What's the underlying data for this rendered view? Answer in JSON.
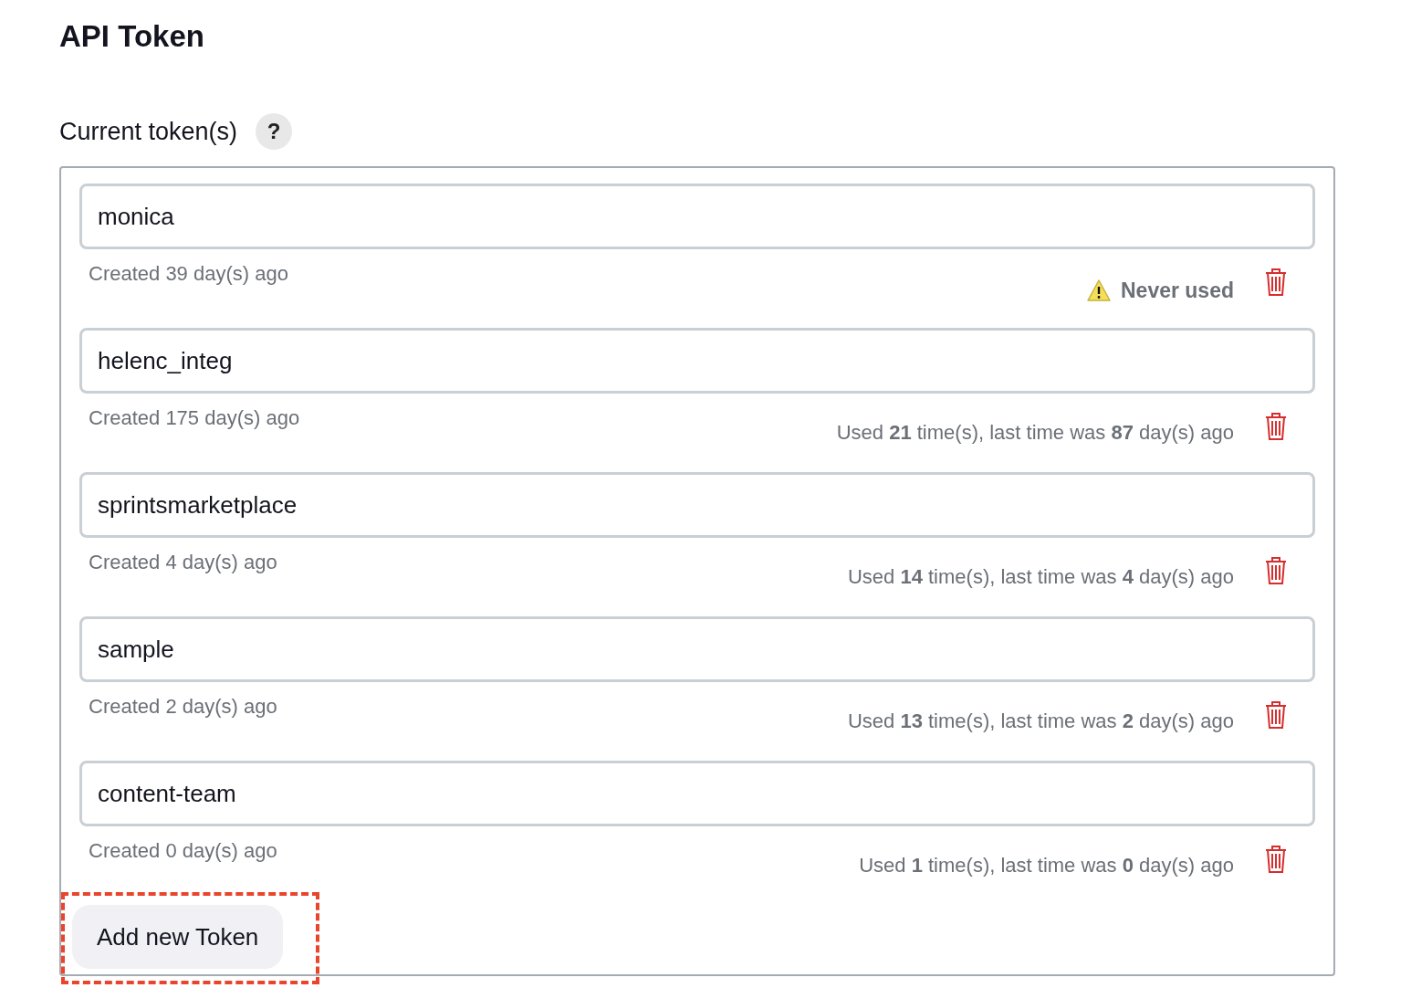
{
  "title": "API Token",
  "section": {
    "label": "Current token(s)",
    "help": "?"
  },
  "tokens": [
    {
      "name": "monica",
      "created": "Created 39 day(s) ago",
      "usage": {
        "kind": "never",
        "text": "Never used"
      }
    },
    {
      "name": "helenc_integ",
      "created": "Created 175 day(s) ago",
      "usage": {
        "kind": "used",
        "text": "Used **21** time(s), last time was **87** day(s) ago"
      }
    },
    {
      "name": "sprintsmarketplace",
      "created": "Created 4 day(s) ago",
      "usage": {
        "kind": "used",
        "text": "Used **14** time(s), last time was **4** day(s) ago"
      }
    },
    {
      "name": "sample",
      "created": "Created 2 day(s) ago",
      "usage": {
        "kind": "used",
        "text": "Used **13** time(s), last time was **2** day(s) ago"
      }
    },
    {
      "name": "content-team",
      "created": "Created 0 day(s) ago",
      "usage": {
        "kind": "used",
        "text": "Used **1** time(s), last time was **0** day(s) ago"
      }
    }
  ],
  "add_button": {
    "label": "Add new Token",
    "highlighted": true
  }
}
